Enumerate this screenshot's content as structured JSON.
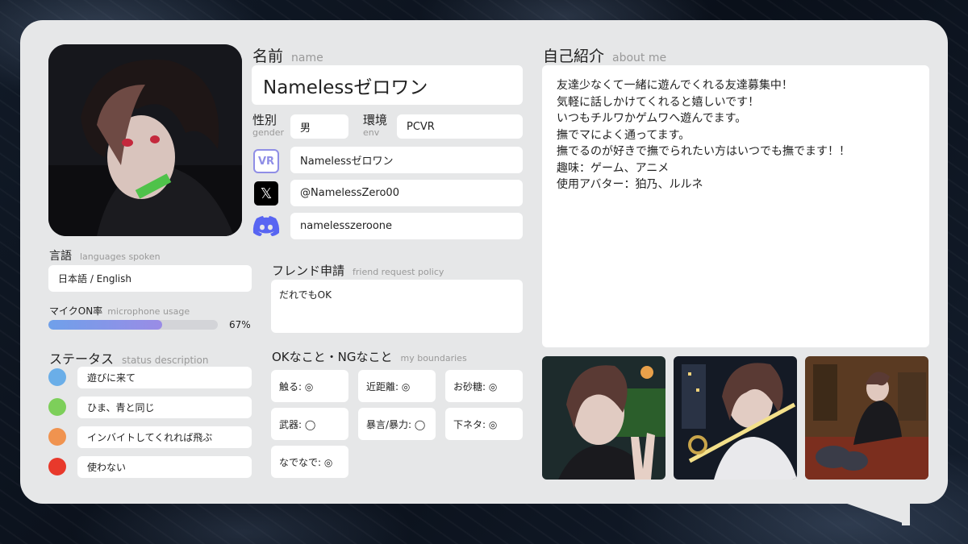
{
  "name": {
    "label": "名前",
    "sub": "name",
    "value": "Namelessゼロワン"
  },
  "gender": {
    "label": "性別",
    "sub": "gender",
    "value": "男"
  },
  "env": {
    "label": "環境",
    "sub": "env",
    "value": "PCVR"
  },
  "vrchat": {
    "icon_text": "VR",
    "value": "Namelessゼロワン"
  },
  "x": {
    "icon_text": "𝕏",
    "value": "@NamelessZero00"
  },
  "discord": {
    "value": "namelesszeroone"
  },
  "languages": {
    "label": "言語",
    "sub": "languages spoken",
    "value": "日本語 / English"
  },
  "mic": {
    "label": "マイクON率",
    "sub": "microphone usage",
    "percent_text": "67%",
    "fraction": 0.67
  },
  "status": {
    "label": "ステータス",
    "sub": "status description",
    "items": [
      {
        "color": "#6aaee8",
        "text": "遊びに来て"
      },
      {
        "color": "#7dcf5a",
        "text": "ひま、青と同じ"
      },
      {
        "color": "#f0934f",
        "text": "インバイトしてくれれば飛ぶ"
      },
      {
        "color": "#e8392b",
        "text": "使わない"
      }
    ]
  },
  "friend": {
    "label": "フレンド申請",
    "sub": "friend request policy",
    "value": "だれでもOK"
  },
  "boundaries": {
    "label": "OKなこと・NGなこと",
    "sub": "my boundaries",
    "items": [
      "触る: ◎",
      "近距離: ◎",
      "お砂糖: ◎",
      "武器: ◯",
      "暴言/暴力: ◯",
      "下ネタ: ◎",
      "なでなで: ◎"
    ]
  },
  "about": {
    "label": "自己紹介",
    "sub": "about me",
    "lines": [
      "友達少なくて一緒に遊んでくれる友達募集中！",
      "気軽に話しかけてくれると嬉しいです！",
      "いつもチルワかゲムワへ遊んでます。",
      "撫でマによく通ってます。",
      "撫でるのが好きで撫でられたい方はいつでも撫でます！！",
      "趣味：ゲーム、アニメ",
      "使用アバター：狛乃、ルルネ"
    ]
  },
  "colors": {
    "card": "#e6e7e8",
    "mic_bar": "#7f98e8",
    "discord": "#5865f2"
  }
}
